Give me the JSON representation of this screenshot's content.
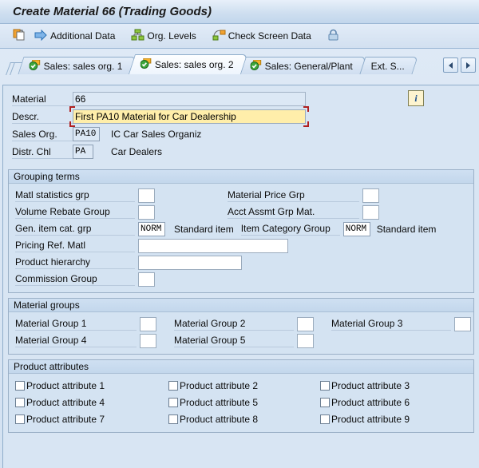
{
  "window": {
    "title": "Create Material 66 (Trading Goods)"
  },
  "toolbar": {
    "items": [
      {
        "icon": "copy-document-icon",
        "label": ""
      },
      {
        "icon": "arrow-right-icon",
        "label": "Additional Data"
      },
      {
        "icon": "org-levels-icon",
        "label": "Org. Levels"
      },
      {
        "icon": "check-screen-icon",
        "label": "Check Screen Data"
      },
      {
        "icon": "lock-icon",
        "label": ""
      }
    ]
  },
  "tabs": [
    {
      "label": "Sales: sales org. 1",
      "active": false
    },
    {
      "label": "Sales: sales org. 2",
      "active": true
    },
    {
      "label": "Sales: General/Plant",
      "active": false
    },
    {
      "label": "Ext. S...",
      "active": false
    }
  ],
  "tab_scroll": {
    "prev": "◄",
    "next": "►"
  },
  "header_fields": {
    "material_label": "Material",
    "material_value": "66",
    "descr_label": "Descr.",
    "descr_value": "First PA10 Material for Car Dealership",
    "sales_org_label": "Sales Org.",
    "sales_org_value": "PA10",
    "sales_org_text": "IC Car Sales Organiz",
    "distr_chl_label": "Distr. Chl",
    "distr_chl_value": "PA",
    "distr_chl_text": "Car Dealers",
    "info_icon": "info-icon"
  },
  "grouping_terms": {
    "title": "Grouping terms",
    "rows": [
      {
        "left_label": "Matl statistics grp",
        "left_value": "",
        "right_label": "Material Price Grp",
        "right_value": ""
      },
      {
        "left_label": "Volume Rebate Group",
        "left_value": "",
        "right_label": "Acct Assmt Grp Mat.",
        "right_value": ""
      }
    ],
    "cat_row": {
      "left_label": "Gen. item cat. grp",
      "left_value": "NORM",
      "left_text": "Standard item",
      "right_label": "Item Category Group",
      "right_value": "NORM",
      "right_text": "Standard item"
    },
    "pricing_ref_label": "Pricing Ref. Matl",
    "pricing_ref_value": "",
    "product_hierarchy_label": "Product hierarchy",
    "product_hierarchy_value": "",
    "commission_group_label": "Commission Group",
    "commission_group_value": ""
  },
  "material_groups": {
    "title": "Material groups",
    "items": [
      {
        "label": "Material Group 1",
        "value": ""
      },
      {
        "label": "Material Group 2",
        "value": ""
      },
      {
        "label": "Material Group 3",
        "value": ""
      },
      {
        "label": "Material Group 4",
        "value": ""
      },
      {
        "label": "Material Group 5",
        "value": ""
      }
    ]
  },
  "product_attributes": {
    "title": "Product attributes",
    "items": [
      {
        "label": "Product attribute 1",
        "checked": false
      },
      {
        "label": "Product attribute 2",
        "checked": false
      },
      {
        "label": "Product attribute 3",
        "checked": false
      },
      {
        "label": "Product attribute 4",
        "checked": false
      },
      {
        "label": "Product attribute 5",
        "checked": false
      },
      {
        "label": "Product attribute 6",
        "checked": false
      },
      {
        "label": "Product attribute 7",
        "checked": false
      },
      {
        "label": "Product attribute 8",
        "checked": false
      },
      {
        "label": "Product attribute 9",
        "checked": false
      }
    ]
  },
  "colors": {
    "title_bar": "#cfdff0",
    "panel_bg": "#d8e5f3",
    "group_bg": "#d4e3f2",
    "focus_field": "#ffeeaa",
    "focus_bracket": "#b02020",
    "tab_border": "#8fadcb"
  }
}
